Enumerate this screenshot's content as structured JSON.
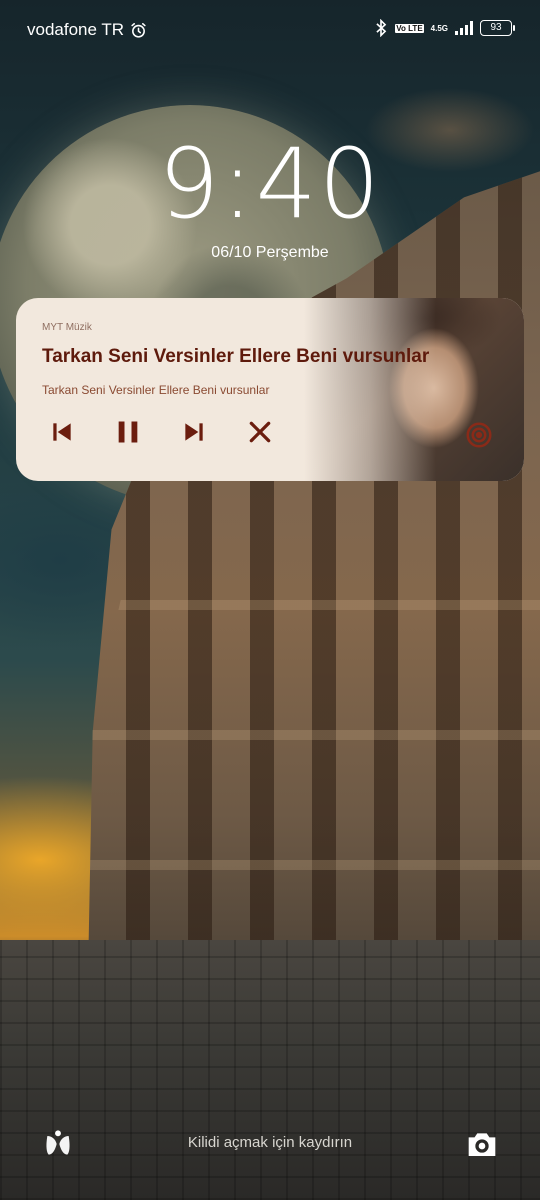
{
  "status_bar": {
    "carrier": "vodafone TR",
    "network_type": "4.5G",
    "volte_label": "Vo LTE",
    "battery": "93"
  },
  "lockscreen": {
    "time": "9:40",
    "date": "06/10 Perşembe",
    "unlock_hint": "Kilidi açmak için kaydırın"
  },
  "media": {
    "app_name": "MYT Müzik",
    "title": "Tarkan Seni Versinler Ellere Beni vursunlar",
    "artist": "Tarkan Seni Versinler Ellere Beni vursunlar",
    "accent_color": "#6b1d0e",
    "card_color": "#f2e8dd"
  },
  "icons": {
    "alarm": "alarm-clock-icon",
    "bluetooth": "bluetooth-icon",
    "signal": "signal-icon",
    "battery": "battery-icon",
    "previous": "skip-previous-icon",
    "pause": "pause-icon",
    "next": "skip-next-icon",
    "close": "close-icon",
    "cast": "cast-icon",
    "shortcut": "shortcut-app-icon",
    "camera": "camera-icon"
  }
}
